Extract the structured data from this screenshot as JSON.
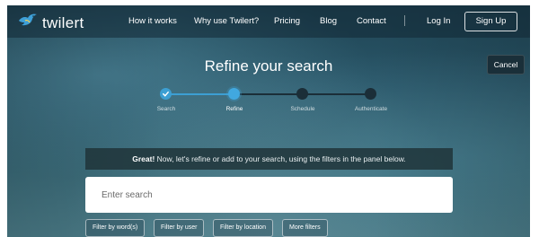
{
  "brand": {
    "name": "twilert",
    "logo_icon": "bird-icon",
    "logo_color": "#3ea0d8"
  },
  "nav": {
    "links": [
      "How it works",
      "Why use Twilert?",
      "Pricing",
      "Blog",
      "Contact"
    ],
    "login": "Log In",
    "signup": "Sign Up"
  },
  "header": {
    "title": "Refine your search",
    "cancel": "Cancel"
  },
  "stepper": {
    "steps": [
      {
        "label": "Search",
        "state": "done"
      },
      {
        "label": "Refine",
        "state": "active"
      },
      {
        "label": "Schedule",
        "state": "todo"
      },
      {
        "label": "Authenticate",
        "state": "todo"
      }
    ],
    "done_color": "#3c9fd3",
    "todo_color": "#1b2e38"
  },
  "banner": {
    "emphasis": "Great!",
    "message": " Now, let's refine or add to your search, using the filters in the panel below."
  },
  "search": {
    "placeholder": "Enter search",
    "value": ""
  },
  "filters": [
    "Filter by word(s)",
    "Filter by user",
    "Filter by location",
    "More filters"
  ]
}
